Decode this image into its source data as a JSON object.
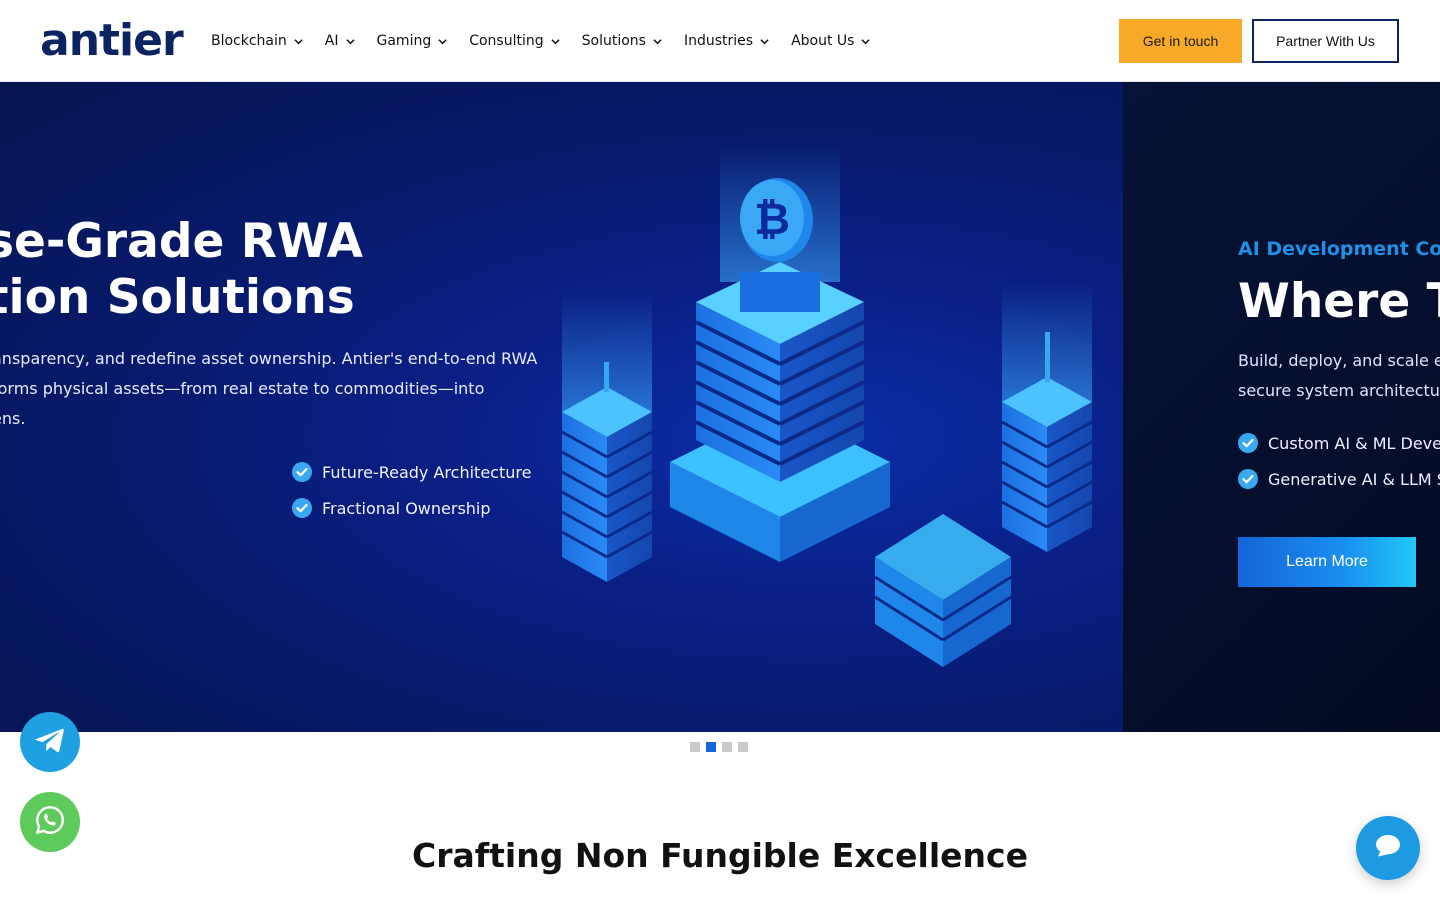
{
  "header": {
    "logo_text": "antier",
    "nav": [
      {
        "label": "Blockchain"
      },
      {
        "label": "AI"
      },
      {
        "label": "Gaming"
      },
      {
        "label": "Consulting"
      },
      {
        "label": "Solutions"
      },
      {
        "label": "Industries"
      },
      {
        "label": "About Us"
      }
    ],
    "cta_primary": "Get in touch",
    "cta_secondary": "Partner With Us"
  },
  "slide_current": {
    "title_line1": "se-Grade RWA",
    "title_line2": "tion Solutions",
    "lead_line1": "ansparency, and redefine asset ownership. Antier's end-to-end RWA",
    "lead_line2": "forms physical assets—from real estate to commodities—into",
    "lead_line3": "ens.",
    "checks": [
      "Future-Ready Architecture",
      "Fractional Ownership"
    ]
  },
  "slide_next": {
    "eyebrow": "AI Development Com",
    "title": "Where Tr",
    "lead_line1": "Build, deploy, and scale ent",
    "lead_line2": "secure system architecture",
    "checks": [
      "Custom AI & ML Develo",
      "Generative AI & LLM So"
    ],
    "button": "Learn More"
  },
  "slider": {
    "count": 4,
    "active_index": 1
  },
  "section": {
    "title": "Crafting Non Fungible Excellence"
  },
  "colors": {
    "brand_navy": "#0c2461",
    "accent_orange": "#f7a928",
    "hero_blue": "#0a2088",
    "eyebrow_blue": "#1e90e6",
    "telegram": "#1fa0e0",
    "whatsapp": "#5fca5c",
    "chat": "#1e9ae3"
  },
  "icons": {
    "nav_chevron": "chevron-down-icon",
    "check": "check-circle-icon",
    "telegram": "telegram-icon",
    "whatsapp": "whatsapp-icon",
    "chat": "chat-bubble-icon",
    "hero_art": "bitcoin-city-illustration"
  }
}
